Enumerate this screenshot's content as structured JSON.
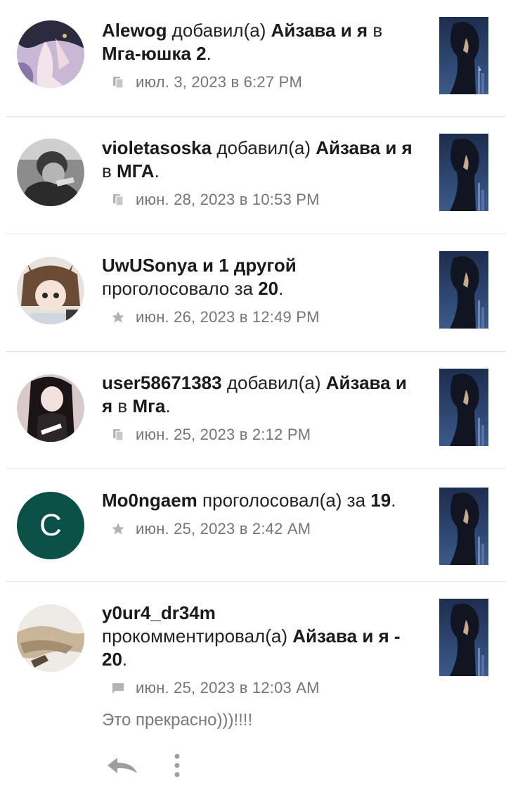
{
  "notifications": [
    {
      "user": "Alewog",
      "action": " добавил(а) ",
      "target": "Айзава и я",
      "joiner": " в ",
      "target2": "Мга-юшка 2",
      "end": ".",
      "icon": "copy-icon",
      "time": "июл. 3, 2023 в 6:27 PM"
    },
    {
      "user": "violetasoska",
      "action": " добавил(а) ",
      "target": "Айзава и я",
      "joiner": " в ",
      "target2": "МГА",
      "end": ".",
      "icon": "copy-icon",
      "time": "июн. 28, 2023 в 10:53 PM"
    },
    {
      "user": "UwUSonya и 1 другой",
      "action": " проголосовало за ",
      "target": "20",
      "end": ".",
      "icon": "star-icon",
      "time": "июн. 26, 2023 в 12:49 PM"
    },
    {
      "user": "user58671383",
      "action": " добавил(а) ",
      "target": "Айзава и я",
      "joiner": " в ",
      "target2": "Мга",
      "end": ".",
      "icon": "copy-icon",
      "time": "июн. 25, 2023 в 2:12 PM"
    },
    {
      "user": "Mo0ngaem",
      "action": " проголосовал(а) за ",
      "target": "19",
      "end": ".",
      "icon": "star-icon",
      "avatar_letter": "C",
      "time": "июн. 25, 2023 в 2:42 AM"
    },
    {
      "user": "y0ur4_dr34m",
      "action": " прокомментировал(а) ",
      "target": "Айзава и я - 20",
      "end": ".",
      "icon": "comment-icon",
      "time": "июн. 25, 2023 в 12:03 AM",
      "comment": "Это прекрасно)))!!!!"
    }
  ],
  "colors": {
    "meta_icon": "#b3b3b3",
    "letter_avatar_bg": "#0b5148",
    "action_icon": "#9e9e9e"
  }
}
